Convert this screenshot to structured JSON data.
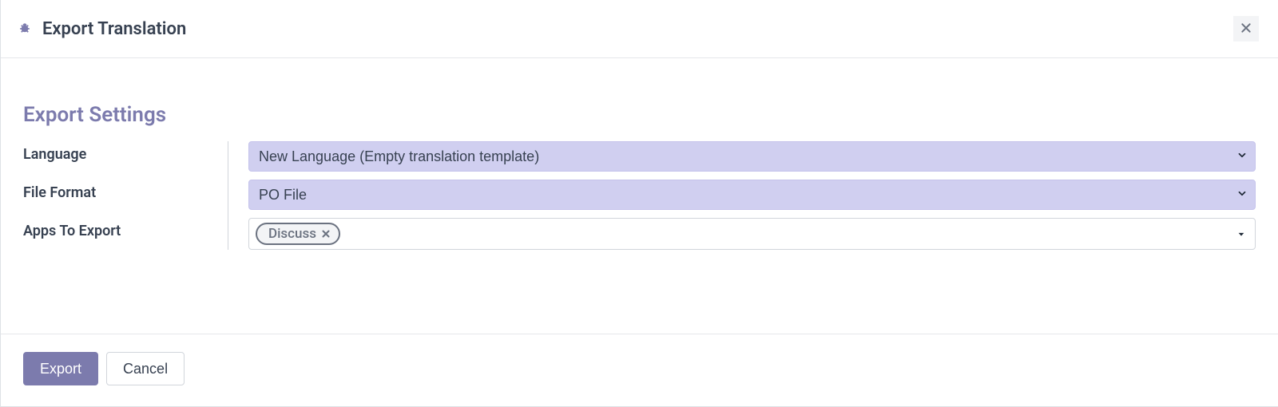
{
  "colors": {
    "accent": "#7c7bad",
    "lavender_field": "#d0cff0"
  },
  "dialog": {
    "title": "Export Translation",
    "section_heading": "Export Settings",
    "fields": {
      "language": {
        "label": "Language",
        "value": "New Language (Empty translation template)"
      },
      "file_format": {
        "label": "File Format",
        "value": "PO File"
      },
      "apps_to_export": {
        "label": "Apps To Export",
        "tags": [
          {
            "label": "Discuss"
          }
        ]
      }
    },
    "footer": {
      "primary_label": "Export",
      "secondary_label": "Cancel"
    }
  },
  "icons": {
    "bug": "bug-icon",
    "close": "close-icon",
    "caret_down": "chevron-down-icon",
    "tag_remove": "close-icon",
    "dropdown_caret_small": "caret-down-icon"
  }
}
